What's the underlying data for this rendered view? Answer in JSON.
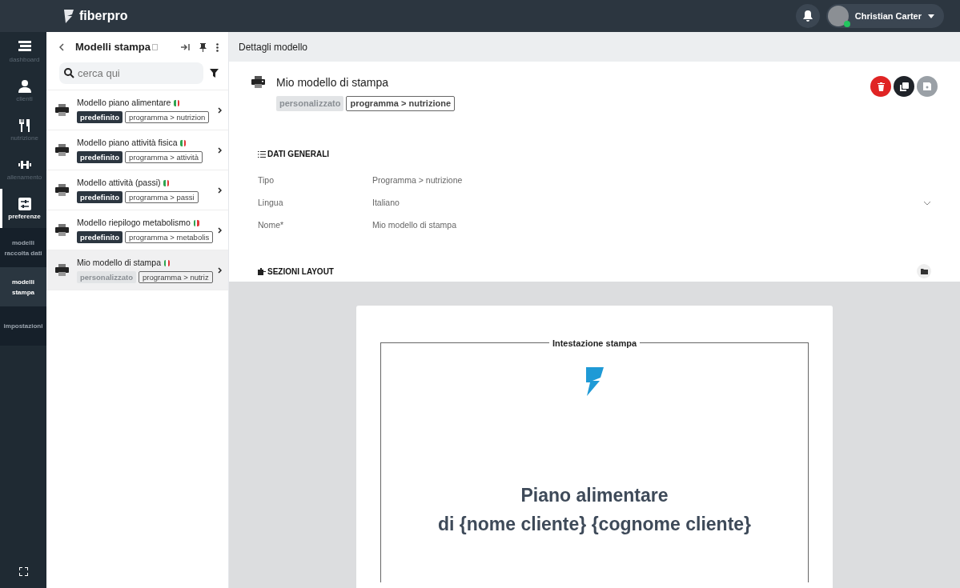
{
  "topbar": {
    "brand": "fiberpro",
    "user": {
      "name": "Christian Carter",
      "online": true
    }
  },
  "nav": {
    "items": [
      {
        "label": "dashboard",
        "kind": "dashboard",
        "selected": false
      },
      {
        "label": "clienti",
        "kind": "user",
        "selected": false
      },
      {
        "label": "nutrizione",
        "kind": "cutlery",
        "selected": false
      },
      {
        "label": "allenamento",
        "kind": "dumbbell",
        "selected": false
      },
      {
        "label": "preferenze",
        "kind": "sliders",
        "selected": true
      }
    ],
    "subitems": [
      {
        "label": "modelli raccolta dati",
        "selected": false
      },
      {
        "label": "modelli stampa",
        "selected": true
      },
      {
        "label": "impostazioni",
        "selected": false
      }
    ]
  },
  "list_panel": {
    "title": "Modelli stampa",
    "search": {
      "placeholder": "cerca qui"
    },
    "items": [
      {
        "title": "Modello piano alimentare",
        "tag": {
          "kind": "default",
          "label": "predefinito"
        },
        "category": "programma > nutrizion",
        "selected": false
      },
      {
        "title": "Modello piano attività fisica",
        "tag": {
          "kind": "default",
          "label": "predefinito"
        },
        "category": "programma > attività",
        "selected": false
      },
      {
        "title": "Modello attività (passi)",
        "tag": {
          "kind": "default",
          "label": "predefinito"
        },
        "category": "programma > passi",
        "selected": false
      },
      {
        "title": "Modello riepilogo metabolismo",
        "tag": {
          "kind": "default",
          "label": "predefinito"
        },
        "category": "programma > metabolis",
        "selected": false
      },
      {
        "title": "Mio modello di stampa",
        "tag": {
          "kind": "custom",
          "label": "personalizzato"
        },
        "category": "programma > nutriz",
        "selected": true
      }
    ]
  },
  "details": {
    "header": "Dettagli modello",
    "title": "Mio modello di stampa",
    "tag": {
      "kind": "custom",
      "label": "personalizzato"
    },
    "category": "programma > nutrizione",
    "general": {
      "heading": "DATI GENERALI",
      "fields": [
        {
          "label": "Tipo",
          "value": "Programma > nutrizione",
          "kind": "text"
        },
        {
          "label": "Lingua",
          "value": "Italiano",
          "kind": "select"
        },
        {
          "label": "Nome*",
          "value": "Mio modello di stampa",
          "kind": "text"
        }
      ]
    },
    "layout_heading": "SEZIONI LAYOUT",
    "preview": {
      "section_label": "Intestazione stampa",
      "title_lines": [
        "Piano alimentare",
        "di {nome cliente} {cognome cliente}"
      ]
    }
  }
}
